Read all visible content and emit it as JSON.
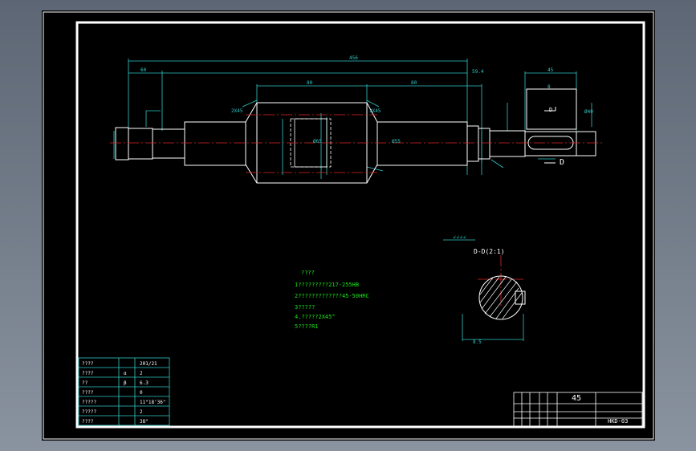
{
  "colors": {
    "background": "#000000",
    "frame": "#ffffff",
    "outline": "#ffffff",
    "centerline": "#e02424",
    "dimension": "#31c8c8",
    "note_text": "#19e619"
  },
  "drawing": {
    "dims": {
      "overall_length": "456",
      "left_segment": "60",
      "mid_segment_1": "80",
      "mid_segment_2": "80",
      "right_segment": "59.4",
      "key_length": "45",
      "key_width": "8",
      "chamfer_left": "2X45",
      "chamfer_right": "2X45",
      "diameter_center": "Ø65",
      "diameter_collar": "Ø55",
      "diameter_right_end": "Ø40"
    },
    "view_label": "D",
    "section_title": "D-D(2:1)",
    "section_dim": "8.5",
    "section_note": "∠∠∠∠",
    "material_code": "45",
    "drawing_number": "HKD-03"
  },
  "tech_notes": {
    "heading": "????",
    "lines": [
      "1?????????217-255HB",
      "2?????????????45-50HRC",
      "3?????",
      "4.?????2X45°",
      "5????R1"
    ]
  },
  "param_table": {
    "rows": [
      {
        "name": "????",
        "sym": "",
        "val": "201/21"
      },
      {
        "name": "????",
        "sym": "α",
        "val": "2"
      },
      {
        "name": "??",
        "sym": "β",
        "val": "6.3"
      },
      {
        "name": "????",
        "sym": "",
        "val": "0"
      },
      {
        "name": "?????",
        "sym": "",
        "val": "11°18'36\""
      },
      {
        "name": "?????",
        "sym": "",
        "val": "2"
      },
      {
        "name": "????",
        "sym": "",
        "val": "38°"
      }
    ]
  }
}
